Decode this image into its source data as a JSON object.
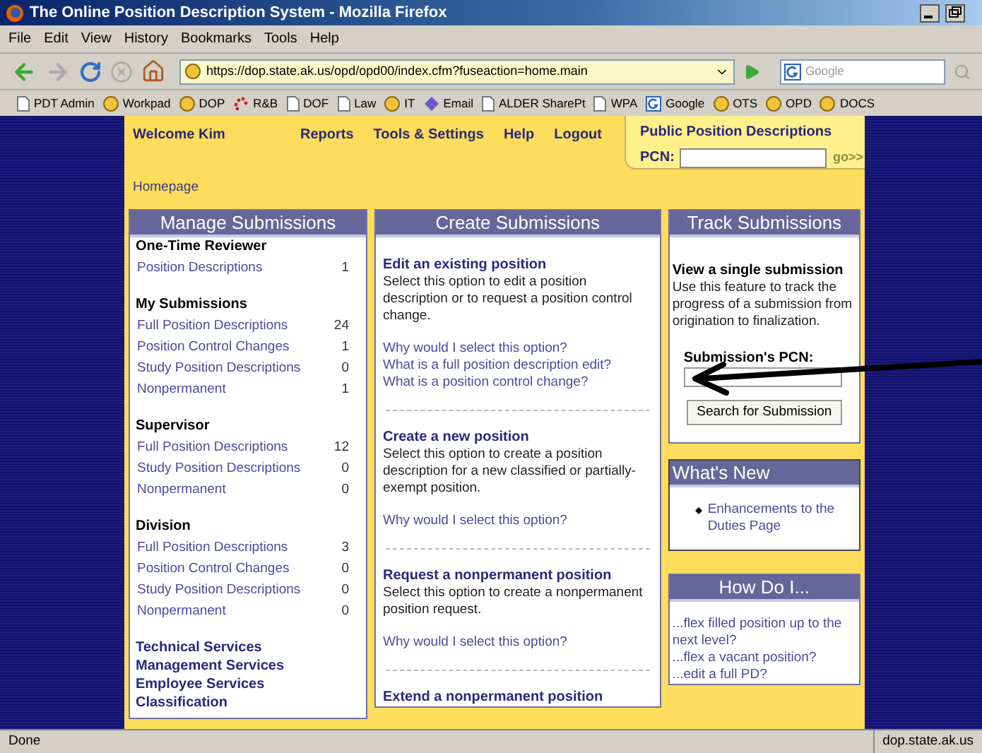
{
  "window": {
    "title": "The Online Position Description System - Mozilla Firefox"
  },
  "menu": [
    "File",
    "Edit",
    "View",
    "History",
    "Bookmarks",
    "Tools",
    "Help"
  ],
  "toolbar": {
    "url": "https://dop.state.ak.us/opd/opd00/index.cfm?fuseaction=home.main",
    "search_placeholder": "Google"
  },
  "bookmarks": [
    {
      "label": "PDT Admin",
      "kind": "page"
    },
    {
      "label": "Workpad",
      "kind": "globe"
    },
    {
      "label": "DOP",
      "kind": "globe"
    },
    {
      "label": "R&B",
      "kind": "dots"
    },
    {
      "label": "DOF",
      "kind": "page"
    },
    {
      "label": "Law",
      "kind": "page"
    },
    {
      "label": "IT",
      "kind": "globe"
    },
    {
      "label": "Email",
      "kind": "diamond"
    },
    {
      "label": "ALDER SharePt",
      "kind": "page"
    },
    {
      "label": "WPA",
      "kind": "page"
    },
    {
      "label": "Google",
      "kind": "search"
    },
    {
      "label": "OTS",
      "kind": "globe"
    },
    {
      "label": "OPD",
      "kind": "globe"
    },
    {
      "label": "DOCS",
      "kind": "globe"
    }
  ],
  "header": {
    "welcome": "Welcome Kim",
    "nav": [
      "Reports",
      "Tools & Settings",
      "Help",
      "Logout"
    ],
    "breadcrumb": "Homepage"
  },
  "public_pd": {
    "title": "Public Position Descriptions",
    "label": "PCN:",
    "go": "go>>"
  },
  "manage": {
    "title": "Manage Submissions",
    "groups": [
      {
        "heading": "One-Time Reviewer",
        "items": [
          {
            "label": "Position Descriptions",
            "count": "1"
          }
        ]
      },
      {
        "heading": "My Submissions",
        "items": [
          {
            "label": "Full Position Descriptions",
            "count": "24"
          },
          {
            "label": "Position Control Changes",
            "count": "1"
          },
          {
            "label": "Study Position Descriptions",
            "count": "0"
          },
          {
            "label": "Nonpermanent",
            "count": "1"
          }
        ]
      },
      {
        "heading": "Supervisor",
        "items": [
          {
            "label": "Full Position Descriptions",
            "count": "12"
          },
          {
            "label": "Study Position Descriptions",
            "count": "0"
          },
          {
            "label": "Nonpermanent",
            "count": "0"
          }
        ]
      },
      {
        "heading": "Division",
        "items": [
          {
            "label": "Full Position Descriptions",
            "count": "3"
          },
          {
            "label": "Position Control Changes",
            "count": "0"
          },
          {
            "label": "Study Position Descriptions",
            "count": "0"
          },
          {
            "label": "Nonpermanent",
            "count": "0"
          }
        ]
      }
    ],
    "links": [
      "Technical Services",
      "Management Services",
      "Employee Services",
      "Classification"
    ]
  },
  "create": {
    "title": "Create Submissions",
    "sections": [
      {
        "heading": "Edit an existing position",
        "text": "Select this option to edit a position description or to request a position control change.",
        "links": [
          "Why would I select this option?",
          "What is a full position description edit?",
          "What is a position control change?"
        ]
      },
      {
        "heading": "Create a new position",
        "text": "Select this option to create a position description for a new classified or partially-exempt position.",
        "links": [
          "Why would I select this option?"
        ]
      },
      {
        "heading": "Request a nonpermanent position",
        "text": "Select this option to create a nonpermanent position request.",
        "links": [
          "Why would I select this option?"
        ]
      },
      {
        "heading": "Extend a nonpermanent position"
      }
    ]
  },
  "track": {
    "title": "Track Submissions",
    "heading": "View a single submission",
    "text": "Use this feature to track the progress of a submission from origination to finalization.",
    "field_label": "Submission's PCN:",
    "button": "Search for Submission"
  },
  "whats_new": {
    "title": "What's New",
    "items": [
      "Enhancements to the Duties Page"
    ]
  },
  "how_do_i": {
    "title": "How Do I...",
    "links": [
      "...flex filled position up to the next level?",
      "...flex a vacant position?",
      "...edit a full PD?"
    ]
  },
  "status_bar": {
    "text": "Done",
    "domain": "dop.state.ak.us"
  }
}
